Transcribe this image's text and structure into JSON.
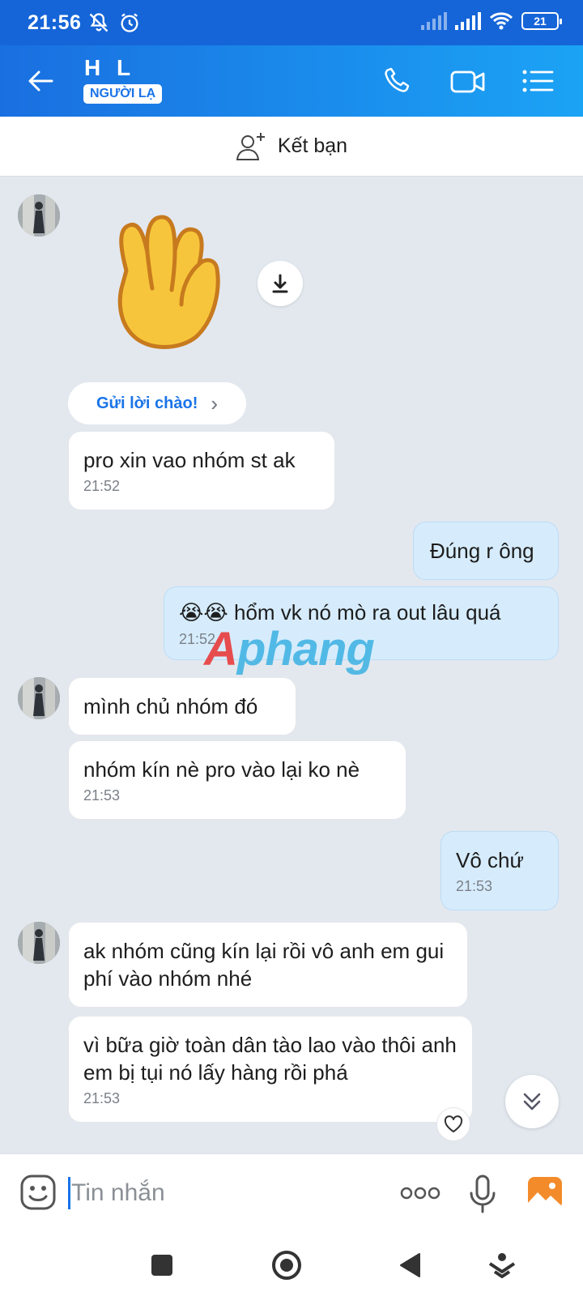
{
  "status_bar": {
    "time": "21:56",
    "battery": "21"
  },
  "header": {
    "contact_name": "H L",
    "badge": "NGƯỜI LẠ"
  },
  "add_friend": {
    "label": "Kết bạn"
  },
  "greeting_button": {
    "label": "Gửi lời chào!",
    "chevron": "›"
  },
  "messages": [
    {
      "side": "in",
      "text": "pro xin vao nhóm st ak",
      "time": "21:52"
    },
    {
      "side": "out",
      "text": "Đúng r ông",
      "time": ""
    },
    {
      "side": "out",
      "emoji": "😭😭",
      "text": "hổm vk nó mò ra out lâu quá",
      "time": "21:52"
    },
    {
      "side": "in",
      "text": "mình chủ nhóm đó",
      "time": ""
    },
    {
      "side": "in",
      "text": "nhóm kín nè pro vào lại ko nè",
      "time": "21:53"
    },
    {
      "side": "out",
      "text": "Vô chứ",
      "time": "21:53"
    },
    {
      "side": "in",
      "text": "ak nhóm cũng kín lại rồi vô anh em gui phí vào nhóm nhé",
      "time": ""
    },
    {
      "side": "in",
      "text": "vì bữa giờ toàn dân tào lao vào thôi anh em bị tụi nó lấy hàng rồi phá",
      "time": "21:53"
    }
  ],
  "watermark": {
    "initial": "A",
    "rest": "phang"
  },
  "input": {
    "placeholder": "Tin nhắn"
  },
  "colors": {
    "header_start": "#1a6fe0",
    "header_end": "#1ba3f5",
    "accent": "#1a74e8",
    "bubble_out": "#d6ecfc"
  }
}
